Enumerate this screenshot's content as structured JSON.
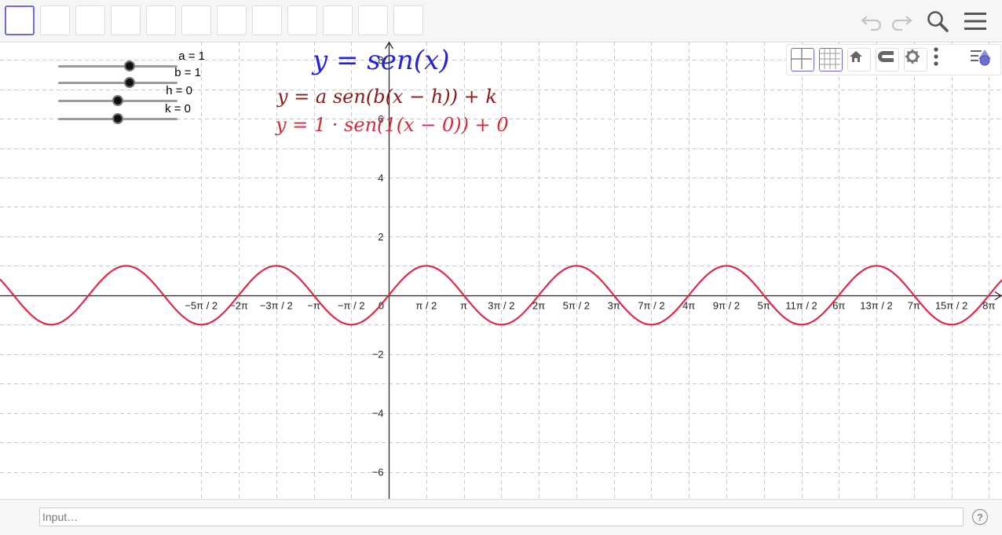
{
  "toolbar": {
    "tool_count": 12,
    "selected_tool": 0,
    "icons": [
      "undo-icon",
      "redo-icon",
      "search-icon",
      "menu-icon"
    ]
  },
  "sliders": [
    {
      "label": "a = 1",
      "value": 1,
      "min": -5,
      "max": 5
    },
    {
      "label": "b = 1",
      "value": 1,
      "min": -5,
      "max": 5
    },
    {
      "label": "h = 0",
      "value": 0,
      "min": -5,
      "max": 5
    },
    {
      "label": "k = 0",
      "value": 0,
      "min": -5,
      "max": 5
    }
  ],
  "equations": {
    "title": "y = sen(x)",
    "general": "y = a sen(b(x − h)) + k",
    "current": "y = 1 · sen(1(x − 0)) + 0"
  },
  "chart_data": {
    "type": "line",
    "xlim": [
      -16.28,
      25.68
    ],
    "ylim": [
      -6.92,
      8.62
    ],
    "x_ticks": [
      {
        "label": "−5π / 2",
        "value": -7.854
      },
      {
        "label": "−2π",
        "value": -6.283
      },
      {
        "label": "−3π / 2",
        "value": -4.712
      },
      {
        "label": "−π",
        "value": -3.142
      },
      {
        "label": "−π / 2",
        "value": -1.571
      },
      {
        "label": "0",
        "value": 0
      },
      {
        "label": "π / 2",
        "value": 1.571
      },
      {
        "label": "π",
        "value": 3.142
      },
      {
        "label": "3π / 2",
        "value": 4.712
      },
      {
        "label": "2π",
        "value": 6.283
      },
      {
        "label": "5π / 2",
        "value": 7.854
      },
      {
        "label": "3π",
        "value": 9.425
      },
      {
        "label": "7π / 2",
        "value": 10.996
      },
      {
        "label": "4π",
        "value": 12.566
      },
      {
        "label": "9π / 2",
        "value": 14.137
      },
      {
        "label": "5π",
        "value": 15.708
      },
      {
        "label": "11π / 2",
        "value": 17.279
      },
      {
        "label": "6π",
        "value": 18.85
      },
      {
        "label": "13π / 2",
        "value": 20.42
      },
      {
        "label": "7π",
        "value": 21.991
      },
      {
        "label": "15π / 2",
        "value": 23.562
      },
      {
        "label": "8π",
        "value": 25.133
      }
    ],
    "y_ticks": [
      {
        "label": "8",
        "value": 8
      },
      {
        "label": "6",
        "value": 6
      },
      {
        "label": "4",
        "value": 4
      },
      {
        "label": "2",
        "value": 2
      },
      {
        "label": "−2",
        "value": -2
      },
      {
        "label": "−4",
        "value": -4
      },
      {
        "label": "−6",
        "value": -6
      }
    ],
    "y_minor_step": 1,
    "grid": true,
    "series": [
      {
        "function": "sin(x)",
        "color": "#dd2a4a"
      }
    ]
  },
  "style_bar": {
    "icons": [
      "axes-icon",
      "grid-icon",
      "home-icon",
      "magnet-icon",
      "settings-icon",
      "more-icon",
      "algebra-toggle-icon"
    ]
  },
  "input_bar": {
    "placeholder": "Input…",
    "help": "?"
  },
  "colors": {
    "curve": "#dd2a4a",
    "title": "#2323d8",
    "general": "#8b1a1a",
    "current": "#d42a3a",
    "tool_selected": "#6e6ed2"
  }
}
